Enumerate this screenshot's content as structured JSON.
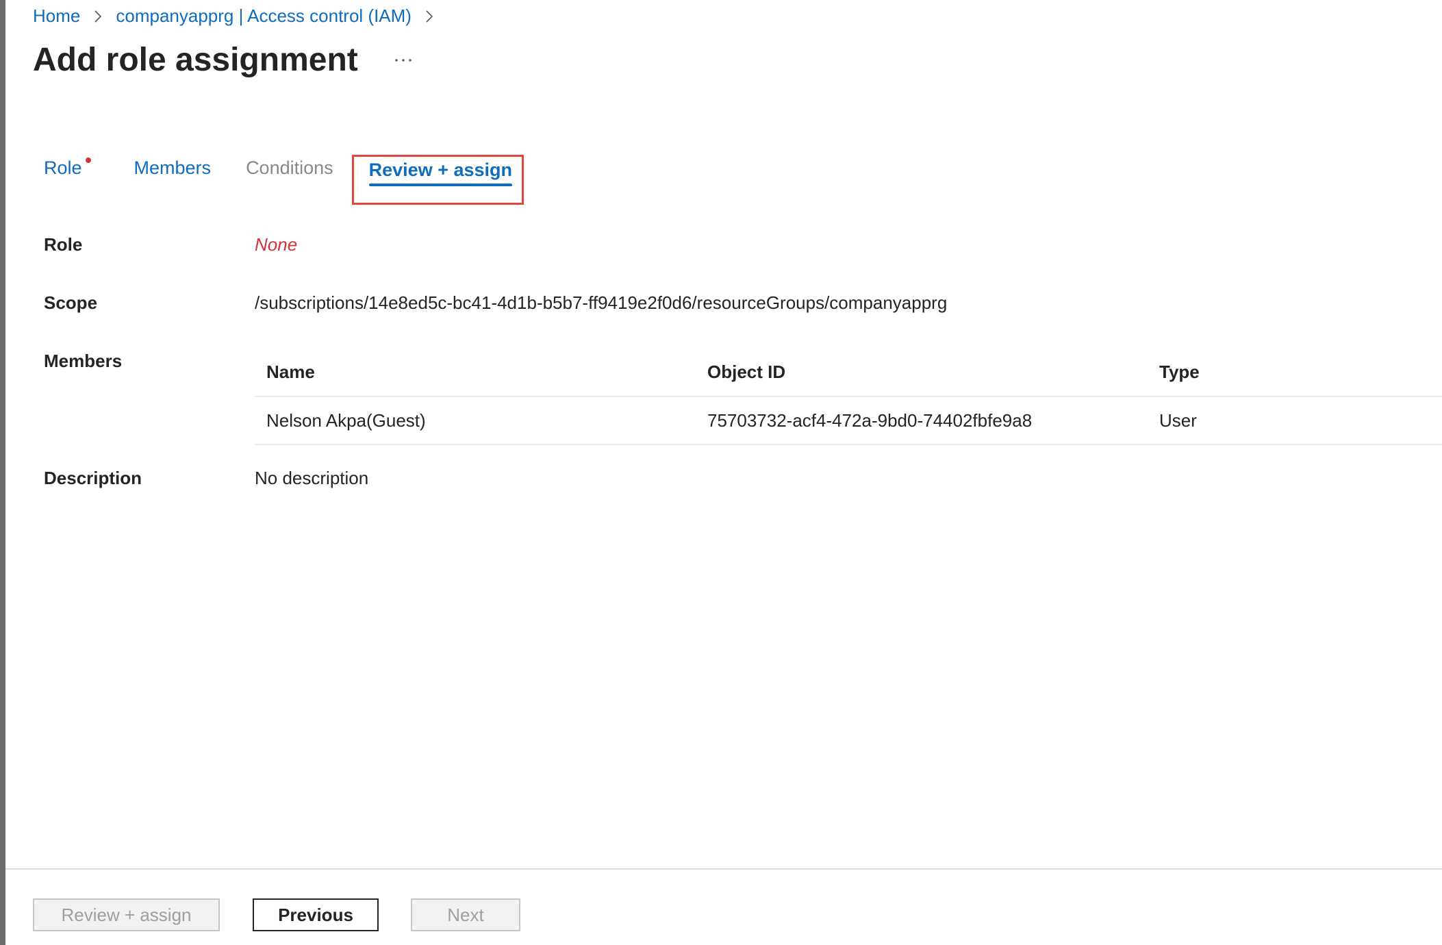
{
  "breadcrumb": {
    "home": "Home",
    "parent": "companyapprg | Access control (IAM)"
  },
  "header": {
    "title": "Add role assignment",
    "more_label": "···"
  },
  "tabs": [
    {
      "label": "Role",
      "required": true
    },
    {
      "label": "Members"
    },
    {
      "label": "Conditions"
    },
    {
      "label": "Review + assign",
      "active": true
    }
  ],
  "details": {
    "role_label": "Role",
    "role_value": "None",
    "scope_label": "Scope",
    "scope_value": "/subscriptions/14e8ed5c-bc41-4d1b-b5b7-ff9419e2f0d6/resourceGroups/companyapprg",
    "members_label": "Members",
    "description_label": "Description",
    "description_value": "No description"
  },
  "members_table": {
    "columns": [
      "Name",
      "Object ID",
      "Type"
    ],
    "rows": [
      {
        "name": "Nelson Akpa(Guest)",
        "object_id": "75703732-acf4-472a-9bd0-74402fbfe9a8",
        "type": "User"
      }
    ]
  },
  "footer": {
    "review_assign": "Review + assign",
    "previous": "Previous",
    "next": "Next"
  },
  "colors": {
    "link": "#0f6cbd",
    "error": "#d13438",
    "highlight_box": "#e1473d"
  }
}
